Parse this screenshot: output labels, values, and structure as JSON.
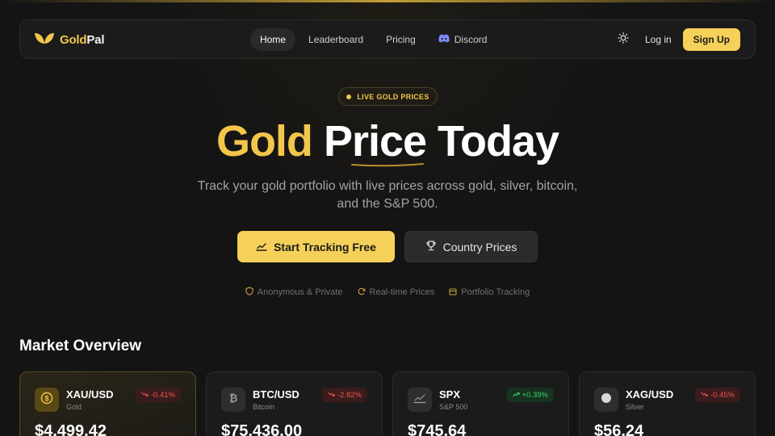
{
  "nav": {
    "brand_prefix": "Gold",
    "brand_suffix": "Pal",
    "links": [
      {
        "label": "Home",
        "active": true
      },
      {
        "label": "Leaderboard",
        "active": false
      },
      {
        "label": "Pricing",
        "active": false
      },
      {
        "label": "Discord",
        "active": false
      }
    ],
    "login_label": "Log in",
    "signup_label": "Sign Up"
  },
  "hero": {
    "badge": "LIVE GOLD PRICES",
    "title_gold": "Gold",
    "title_rest": "Price Today",
    "subtitle": "Track your gold portfolio with live prices across gold, silver, bitcoin, and the S&P 500.",
    "primary_cta": "Start Tracking Free",
    "secondary_cta": "Country Prices",
    "features": [
      {
        "label": "Anonymous & Private",
        "icon": "shield-icon"
      },
      {
        "label": "Real-time Prices",
        "icon": "refresh-icon"
      },
      {
        "label": "Portfolio Tracking",
        "icon": "wallet-icon"
      }
    ]
  },
  "market": {
    "title": "Market Overview",
    "cards": [
      {
        "symbol": "XAU/USD",
        "name": "Gold",
        "change": "-0.41%",
        "direction": "down",
        "price": "$4,499.42",
        "icon": "coin-icon"
      },
      {
        "symbol": "BTC/USD",
        "name": "Bitcoin",
        "change": "-2.82%",
        "direction": "down",
        "price": "$75,436.00",
        "icon": "bitcoin-icon"
      },
      {
        "symbol": "SPX",
        "name": "S&P 500",
        "change": "+0.39%",
        "direction": "up",
        "price": "$745.64",
        "icon": "chart-line-icon"
      },
      {
        "symbol": "XAG/USD",
        "name": "Silver",
        "change": "-0.45%",
        "direction": "down",
        "price": "$56.24",
        "icon": "silver-coin-icon"
      }
    ]
  },
  "colors": {
    "accent": "#f3c64a",
    "button": "#f6d15a",
    "background": "#141414",
    "negative": "#ef5350",
    "positive": "#3ecf6b"
  }
}
